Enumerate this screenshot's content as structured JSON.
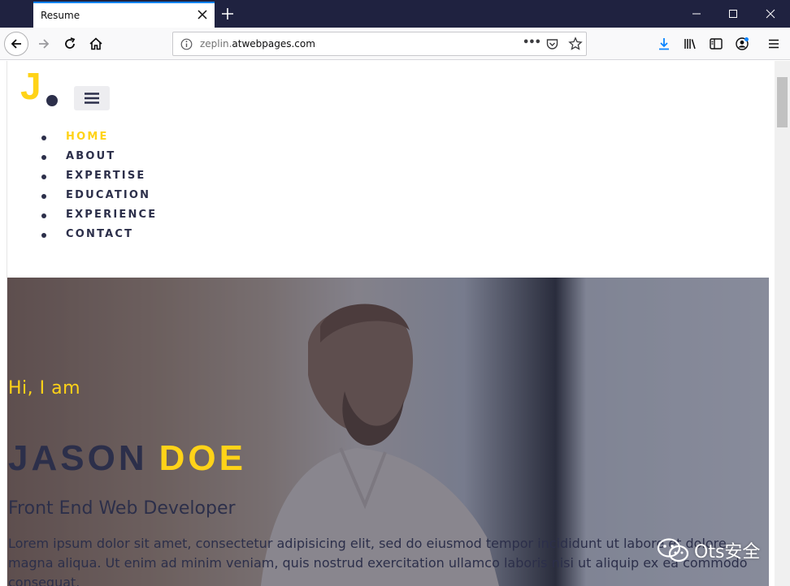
{
  "browser": {
    "tab_title": "Resume",
    "url_prefix": "zeplin.",
    "url_host": "atwebpages.com",
    "url_more": "•••"
  },
  "page": {
    "logo_letter": "J",
    "nav_items": [
      {
        "label": "HOME",
        "active": true
      },
      {
        "label": "ABOUT",
        "active": false
      },
      {
        "label": "EXPERTISE",
        "active": false
      },
      {
        "label": "EDUCATION",
        "active": false
      },
      {
        "label": "EXPERIENCE",
        "active": false
      },
      {
        "label": "CONTACT",
        "active": false
      }
    ],
    "hero": {
      "greeting": "Hi, I am",
      "first_name": "JASON",
      "last_name": "DOE",
      "role": "Front End Web Developer",
      "paragraph": "Lorem ipsum dolor sit amet, consectetur adipisicing elit, sed do eiusmod tempor incididunt ut labore et dolore magna aliqua. Ut enim ad minim veniam, quis nostrud exercitation ullamco laboris nisi ut aliquip ex ea commodo consequat."
    }
  },
  "watermark": {
    "text": "Ots安全"
  },
  "colors": {
    "accent": "#ffd318",
    "dark": "#2c2f4a",
    "titlebar": "#1f2240"
  }
}
